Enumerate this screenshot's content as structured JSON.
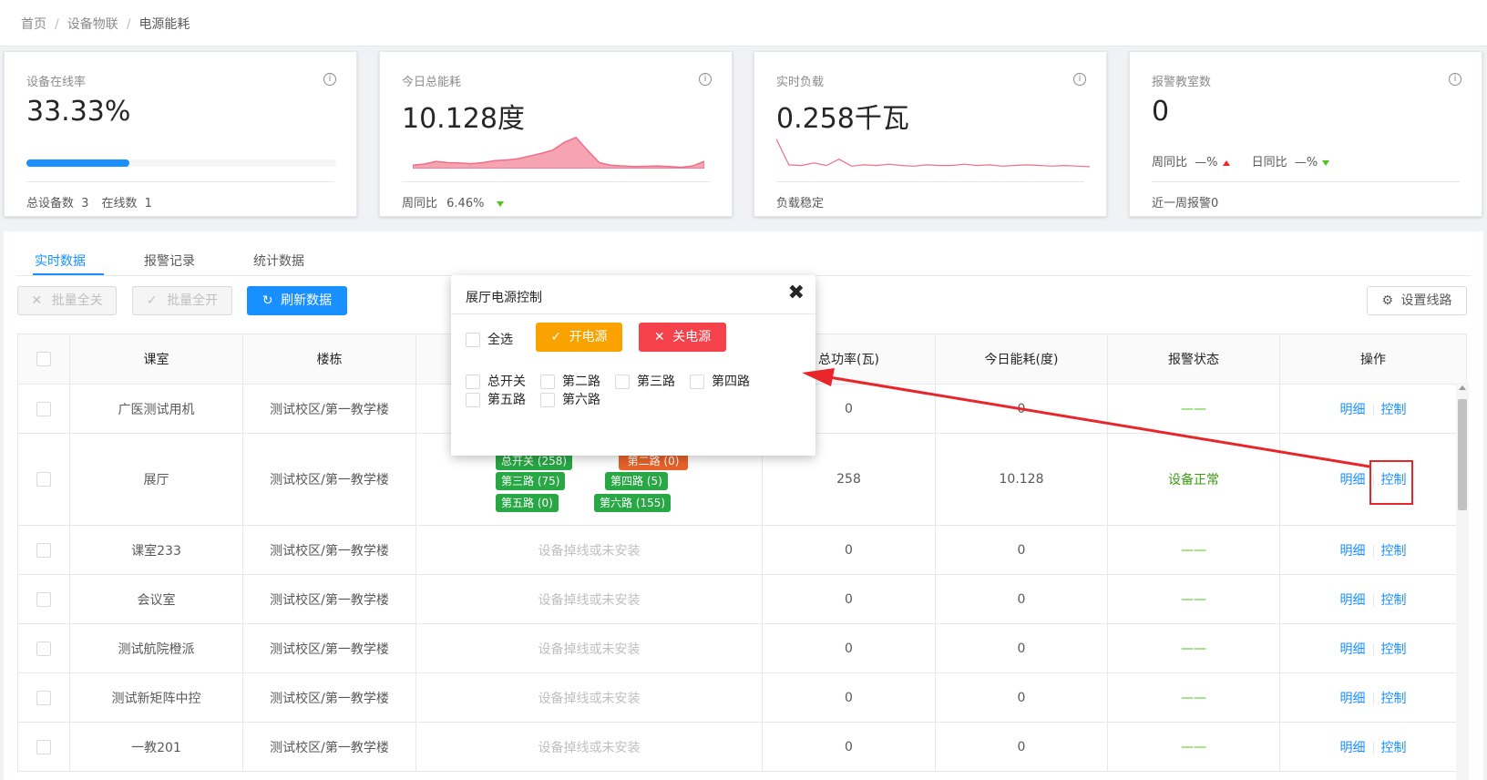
{
  "breadcrumb": {
    "home": "首页",
    "sep": "/",
    "section": "设备物联",
    "current": "电源能耗"
  },
  "cards": [
    {
      "label": "设备在线率",
      "value": "33.33%",
      "progress": 0.3333,
      "footer": {
        "total_label": "总设备数",
        "total": "3",
        "online_label": "在线数",
        "online": "1"
      }
    },
    {
      "label": "今日总能耗",
      "value": "10.128度",
      "footer": {
        "wow_label": "周同比",
        "wow": "6.46%"
      }
    },
    {
      "label": "实时负载",
      "value": "0.258千瓦",
      "footer": {
        "text": "负载稳定"
      }
    },
    {
      "label": "报警教室数",
      "value": "0",
      "wow_label": "周同比",
      "wow": "—%",
      "dod_label": "日同比",
      "dod": "—%",
      "footer": {
        "text": "近一周报警0"
      }
    }
  ],
  "tabs": [
    "实时数据",
    "报警记录",
    "统计数据"
  ],
  "toolbar": {
    "batch_off": "批量全关",
    "batch_on": "批量全开",
    "refresh": "刷新数据",
    "settings": "设置线路"
  },
  "table": {
    "headers": [
      "课室",
      "楼栋",
      "",
      "总功率(瓦)",
      "今日能耗(度)",
      "报警状态",
      "操作"
    ],
    "rows": [
      {
        "room": "广医测试用机",
        "building": "测试校区/第一教学楼",
        "status": "",
        "power": "0",
        "energy": "0",
        "alarm": "——"
      },
      {
        "room": "展厅",
        "building": "测试校区/第一教学楼",
        "status": "",
        "power": "258",
        "energy": "10.128",
        "alarm": "设备正常"
      },
      {
        "room": "课室233",
        "building": "测试校区/第一教学楼",
        "status": "设备掉线或未安装",
        "power": "0",
        "energy": "0",
        "alarm": "——"
      },
      {
        "room": "会议室",
        "building": "测试校区/第一教学楼",
        "status": "设备掉线或未安装",
        "power": "0",
        "energy": "0",
        "alarm": "——"
      },
      {
        "room": "测试航院橙派",
        "building": "测试校区/第一教学楼",
        "status": "设备掉线或未安装",
        "power": "0",
        "energy": "0",
        "alarm": "——"
      },
      {
        "room": "测试新矩阵中控",
        "building": "测试校区/第一教学楼",
        "status": "设备掉线或未安装",
        "power": "0",
        "energy": "0",
        "alarm": "——"
      },
      {
        "room": "一教201",
        "building": "测试校区/第一教学楼",
        "status": "设备掉线或未安装",
        "power": "0",
        "energy": "0",
        "alarm": "——"
      }
    ],
    "op_detail": "明细",
    "op_control": "控制",
    "tags": {
      "main": "总开关 (258)",
      "l2": "第二路 (0)",
      "l3": "第三路 (75)",
      "l4": "第四路 (5)",
      "l5": "第五路 (0)",
      "l6": "第六路 (155)"
    }
  },
  "modal": {
    "title": "展厅电源控制",
    "close": "✖",
    "select_all": "全选",
    "on": "开电源",
    "off": "关电源",
    "circuits": [
      "总开关",
      "第二路",
      "第三路",
      "第四路",
      "第五路",
      "第六路"
    ]
  },
  "colors": {
    "primary": "#1890ff",
    "warn": "#faa300",
    "danger": "#f5424a",
    "ok": "#28a745",
    "annotation": "#e8262a"
  },
  "energy_trend": [
    0.1,
    0.14,
    0.22,
    0.18,
    0.17,
    0.15,
    0.18,
    0.24,
    0.26,
    0.3,
    0.38,
    0.46,
    0.56,
    0.8,
    0.95,
    0.55,
    0.18,
    0.1,
    0.08,
    0.06,
    0.07,
    0.08,
    0.06,
    0.04,
    0.08,
    0.22
  ],
  "load_trend": [
    0.95,
    0.12,
    0.1,
    0.18,
    0.1,
    0.3,
    0.08,
    0.12,
    0.1,
    0.14,
    0.1,
    0.08,
    0.12,
    0.1,
    0.1,
    0.14,
    0.1,
    0.12,
    0.08,
    0.1,
    0.12,
    0.1,
    0.08,
    0.1,
    0.08,
    0.06
  ]
}
